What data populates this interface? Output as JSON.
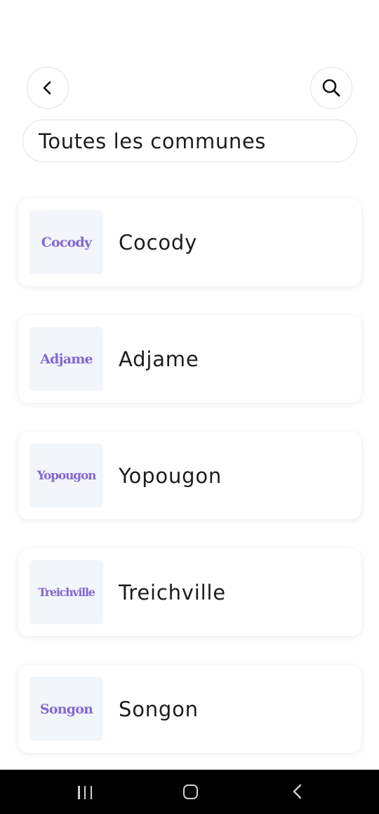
{
  "header": {
    "back_icon": "chevron-left-icon",
    "search_icon": "search-icon",
    "title": "Toutes les communes"
  },
  "communes": [
    {
      "name": "Cocody",
      "logo_text": "Cocody"
    },
    {
      "name": "Adjame",
      "logo_text": "Adjame"
    },
    {
      "name": "Yopougon",
      "logo_text": "Yopougon"
    },
    {
      "name": "Treichville",
      "logo_text": "Treichville"
    },
    {
      "name": "Songon",
      "logo_text": "Songon"
    }
  ],
  "colors": {
    "logo_accent": "#8468d2",
    "thumb_bg": "#f2f5fa",
    "text": "#1c1c1e",
    "border": "#e3e3e6"
  },
  "system_nav": {
    "recent_icon": "recent-apps-icon",
    "home_icon": "home-icon",
    "back_icon": "system-back-icon"
  }
}
